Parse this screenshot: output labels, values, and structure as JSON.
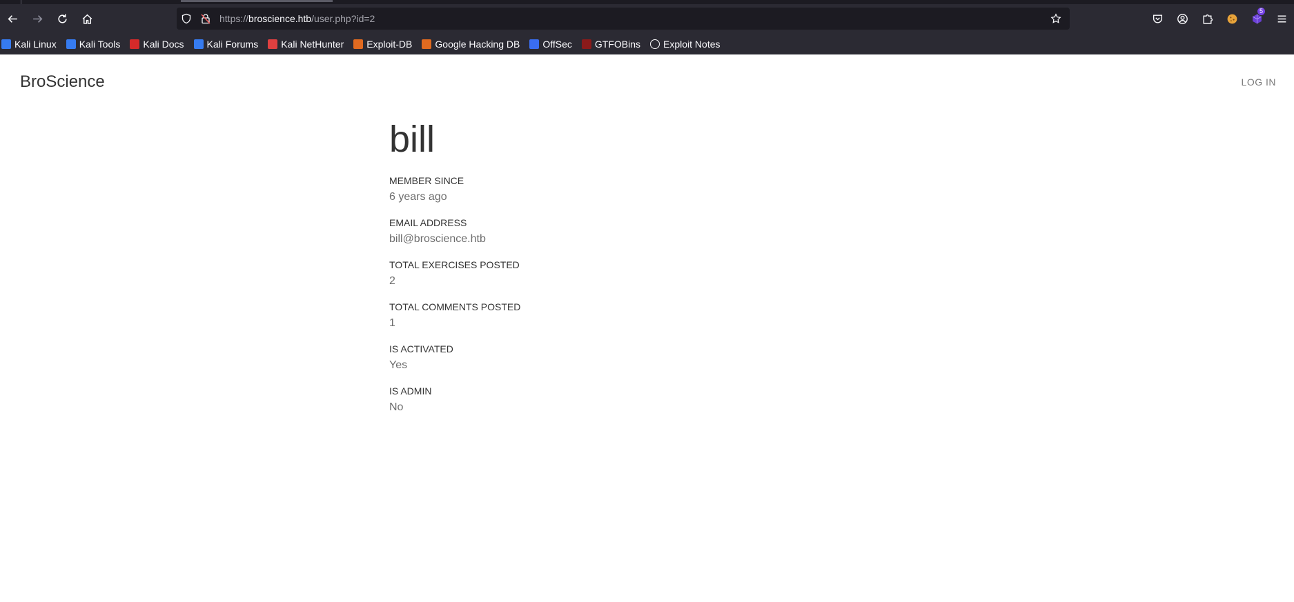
{
  "browser": {
    "url_scheme": "https://",
    "url_host": "broscience.htb",
    "url_path": "/user.php?id=2",
    "extension_badge": "5"
  },
  "bookmarks": [
    {
      "label": "Kali Linux",
      "icon": "kali-dragon-icon",
      "color": "#367bf0"
    },
    {
      "label": "Kali Tools",
      "icon": "kali-tools-icon",
      "color": "#367bf0"
    },
    {
      "label": "Kali Docs",
      "icon": "kali-docs-icon",
      "color": "#d52a2a"
    },
    {
      "label": "Kali Forums",
      "icon": "kali-forums-icon",
      "color": "#367bf0"
    },
    {
      "label": "Kali NetHunter",
      "icon": "kali-nethunter-icon",
      "color": "#e04040"
    },
    {
      "label": "Exploit-DB",
      "icon": "exploit-db-icon",
      "color": "#e06a20"
    },
    {
      "label": "Google Hacking DB",
      "icon": "ghdb-icon",
      "color": "#e06a20"
    },
    {
      "label": "OffSec",
      "icon": "offsec-icon",
      "color": "#3a6df0"
    },
    {
      "label": "GTFOBins",
      "icon": "gtfobins-icon",
      "color": "#8b1a1a"
    },
    {
      "label": "Exploit Notes",
      "icon": "globe-icon",
      "color": "#fbfbfe"
    }
  ],
  "site": {
    "brand": "BroScience",
    "login_label": "LOG IN"
  },
  "profile": {
    "username": "bill",
    "fields": [
      {
        "label": "MEMBER SINCE",
        "value": "6 years ago"
      },
      {
        "label": "EMAIL ADDRESS",
        "value": "bill@broscience.htb"
      },
      {
        "label": "TOTAL EXERCISES POSTED",
        "value": "2"
      },
      {
        "label": "TOTAL COMMENTS POSTED",
        "value": "1"
      },
      {
        "label": "IS ACTIVATED",
        "value": "Yes"
      },
      {
        "label": "IS ADMIN",
        "value": "No"
      }
    ]
  }
}
